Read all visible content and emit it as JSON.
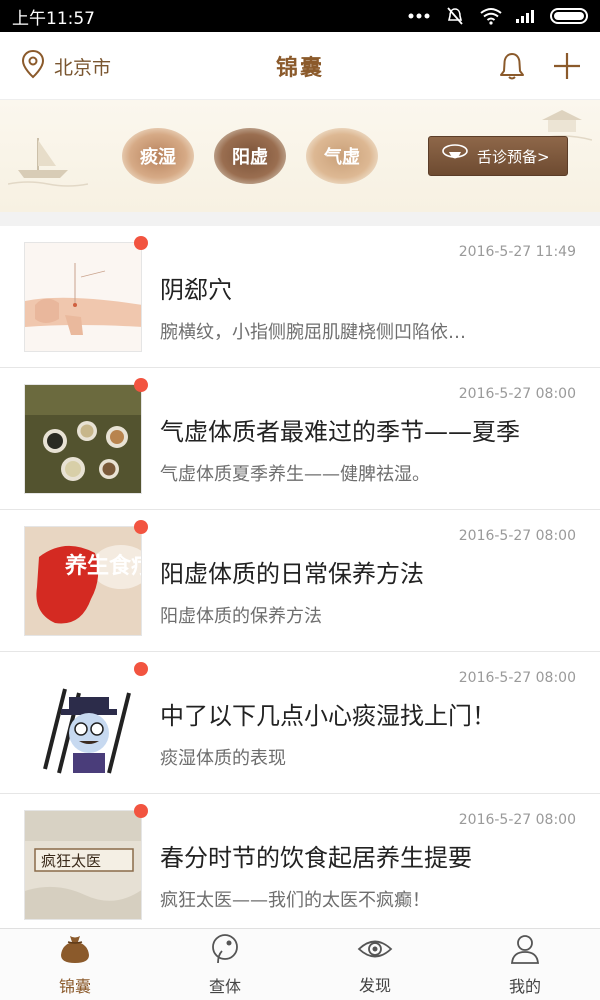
{
  "status_bar": {
    "time": "上午11:57"
  },
  "header": {
    "city": "北京市",
    "title": "锦囊"
  },
  "banner": {
    "constitutions": [
      "痰湿",
      "阳虚",
      "气虚"
    ],
    "tongue_button": "舌诊预备>"
  },
  "articles": [
    {
      "date": "2016-5-27 11:49",
      "title": "阴郄穴",
      "subtitle": "腕横纹，小指侧腕屈肌腱桡侧凹陷依…"
    },
    {
      "date": "2016-5-27 08:00",
      "title": "气虚体质者最难过的季节——夏季",
      "subtitle": "气虚体质夏季养生——健脾祛湿。"
    },
    {
      "date": "2016-5-27 08:00",
      "title": "阳虚体质的日常保养方法",
      "subtitle": "阳虚体质的保养方法"
    },
    {
      "date": "2016-5-27 08:00",
      "title": "中了以下几点小心痰湿找上门！",
      "subtitle": "痰湿体质的表现"
    },
    {
      "date": "2016-5-27 08:00",
      "title": "春分时节的饮食起居养生提要",
      "subtitle": "疯狂太医——我们的太医不疯癫！"
    }
  ],
  "thumb_text": {
    "t3": "养生食疗",
    "t5": "疯狂太医"
  },
  "tabs": [
    {
      "label": "锦囊"
    },
    {
      "label": "查体"
    },
    {
      "label": "发现"
    },
    {
      "label": "我的"
    }
  ],
  "colors": {
    "brand": "#8b5a2b",
    "dot": "#f25440"
  }
}
